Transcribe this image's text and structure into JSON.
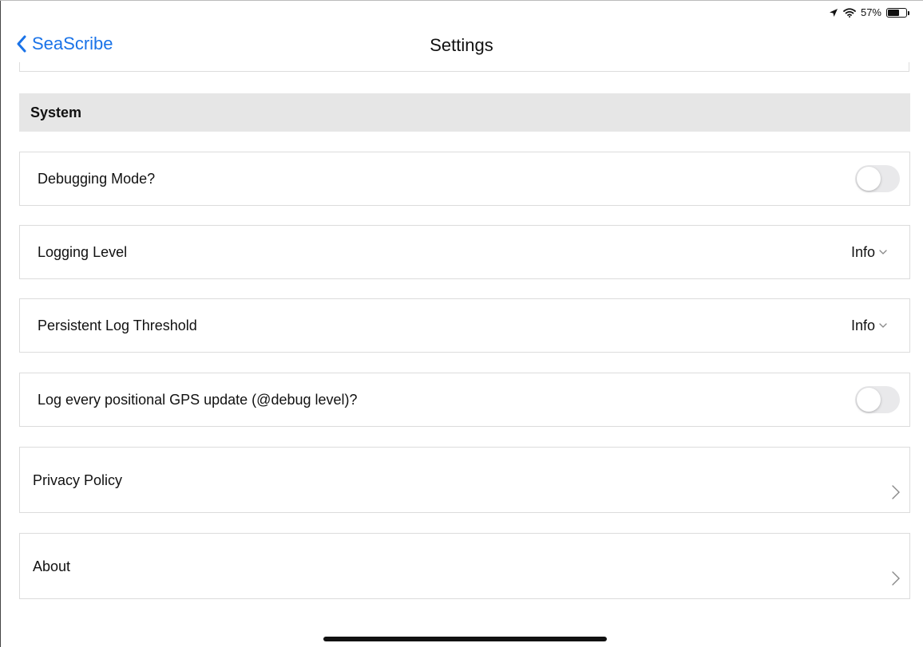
{
  "status_bar": {
    "battery_percent": "57%",
    "battery_level": 0.57,
    "icons": [
      "location-arrow-icon",
      "wifi-icon",
      "battery-icon"
    ]
  },
  "nav": {
    "back_label": "SeaScribe",
    "title": "Settings"
  },
  "section": {
    "title": "System"
  },
  "rows": {
    "debugging_mode": {
      "label": "Debugging Mode?",
      "enabled": false
    },
    "logging_level": {
      "label": "Logging Level",
      "value": "Info"
    },
    "persistent_log_threshold": {
      "label": "Persistent Log Threshold",
      "value": "Info"
    },
    "log_gps": {
      "label": "Log every positional GPS update (@debug level)?",
      "enabled": false
    },
    "privacy_policy": {
      "label": "Privacy Policy"
    },
    "about": {
      "label": "About"
    }
  },
  "colors": {
    "accent": "#1a73e8",
    "section_header_bg": "#e6e6e6",
    "toggle_off": "#e9e9eb"
  }
}
